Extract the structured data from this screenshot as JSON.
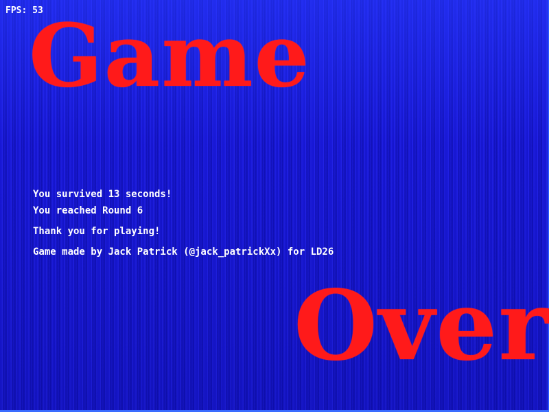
{
  "hud": {
    "fps_text": "FPS: 53"
  },
  "title": {
    "line1": "Game",
    "line2": "Over"
  },
  "messages": {
    "survived": "You survived 13 seconds!",
    "round": "You reached Round 6",
    "thanks": "Thank you for playing!",
    "credits": "Game made by Jack Patrick (@jack_patrickXx) for LD26"
  },
  "colors": {
    "background": "#1212c8",
    "title": "#ff1a1a",
    "text": "#ffffff"
  }
}
